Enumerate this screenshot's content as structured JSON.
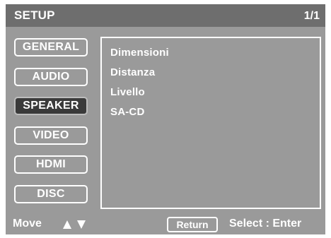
{
  "header": {
    "title": "SETUP",
    "page": "1/1"
  },
  "menu": {
    "items": [
      {
        "label": "GENERAL",
        "selected": false
      },
      {
        "label": "AUDIO",
        "selected": false
      },
      {
        "label": "SPEAKER",
        "selected": true
      },
      {
        "label": "VIDEO",
        "selected": false
      },
      {
        "label": "HDMI",
        "selected": false
      },
      {
        "label": "DISC",
        "selected": false
      }
    ]
  },
  "content": {
    "items": [
      "Dimensioni",
      "Distanza",
      "Livello",
      "SA-CD"
    ]
  },
  "footer": {
    "move_label": "Move",
    "up_icon": "triangle-up-icon",
    "down_icon": "triangle-down-icon",
    "return_label": "Return",
    "select_label": "Select :  Enter"
  },
  "colors": {
    "background": "#9a9a9a",
    "header": "#6e6e6e",
    "selected": "#3a3a3a",
    "text": "#ffffff"
  }
}
